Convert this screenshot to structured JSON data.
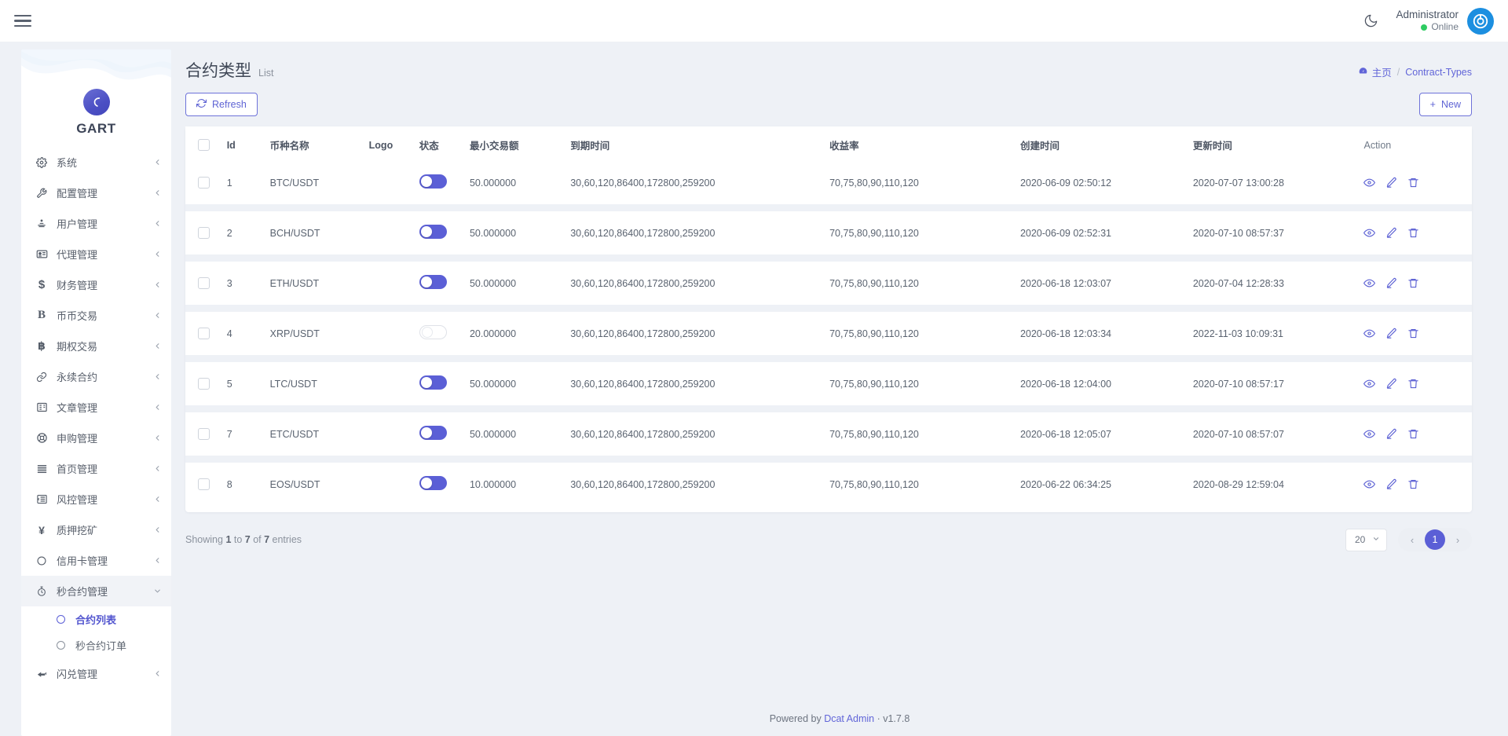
{
  "topbar": {
    "menu_icon": "hamburger-icon",
    "theme_icon": "moon-icon",
    "user_name": "Administrator",
    "user_status": "Online",
    "status_color": "#2ecc62"
  },
  "sidebar": {
    "brand": "GART",
    "items": [
      {
        "label": "系统",
        "icon": "gear-icon",
        "expandable": true
      },
      {
        "label": "配置管理",
        "icon": "wrench-icon",
        "expandable": true
      },
      {
        "label": "用户管理",
        "icon": "users-icon",
        "expandable": true
      },
      {
        "label": "代理管理",
        "icon": "id-card-icon",
        "expandable": true
      },
      {
        "label": "财务管理",
        "icon": "dollar-icon",
        "expandable": true
      },
      {
        "label": "币币交易",
        "icon": "bold-b-icon",
        "expandable": true
      },
      {
        "label": "期权交易",
        "icon": "bitcoin-icon",
        "expandable": true
      },
      {
        "label": "永续合约",
        "icon": "link-icon",
        "expandable": true
      },
      {
        "label": "文章管理",
        "icon": "book-icon",
        "expandable": true
      },
      {
        "label": "申购管理",
        "icon": "lifebuoy-icon",
        "expandable": true
      },
      {
        "label": "首页管理",
        "icon": "bars-icon",
        "expandable": true
      },
      {
        "label": "风控管理",
        "icon": "list-indent-icon",
        "expandable": true
      },
      {
        "label": "质押挖矿",
        "icon": "yen-icon",
        "expandable": true
      },
      {
        "label": "信用卡管理",
        "icon": "circle-icon",
        "expandable": true
      }
    ],
    "expanded_group": {
      "label": "秒合约管理",
      "icon": "stopwatch-icon",
      "children": [
        {
          "label": "合约列表",
          "active": true
        },
        {
          "label": "秒合约订单",
          "active": false
        }
      ]
    },
    "last_item": {
      "label": "闪兑管理",
      "icon": "exchange-icon",
      "expandable": true
    }
  },
  "page": {
    "title": "合约类型",
    "subtitle": "List",
    "breadcrumb": {
      "home": "主页",
      "separator": "/",
      "current": "Contract-Types"
    },
    "refresh_label": "Refresh",
    "new_label": "New"
  },
  "table": {
    "columns": [
      "Id",
      "币种名称",
      "Logo",
      "状态",
      "最小交易额",
      "到期时间",
      "收益率",
      "创建时间",
      "更新时间",
      "Action"
    ],
    "rows": [
      {
        "id": "1",
        "symbol": "BTC/USDT",
        "state": true,
        "min": "50.000000",
        "expiry": "30,60,120,86400,172800,259200",
        "rate": "70,75,80,90,110,120",
        "created": "2020-06-09 02:50:12",
        "updated": "2020-07-07 13:00:28"
      },
      {
        "id": "2",
        "symbol": "BCH/USDT",
        "state": true,
        "min": "50.000000",
        "expiry": "30,60,120,86400,172800,259200",
        "rate": "70,75,80,90,110,120",
        "created": "2020-06-09 02:52:31",
        "updated": "2020-07-10 08:57:37"
      },
      {
        "id": "3",
        "symbol": "ETH/USDT",
        "state": true,
        "min": "50.000000",
        "expiry": "30,60,120,86400,172800,259200",
        "rate": "70,75,80,90,110,120",
        "created": "2020-06-18 12:03:07",
        "updated": "2020-07-04 12:28:33"
      },
      {
        "id": "4",
        "symbol": "XRP/USDT",
        "state": false,
        "min": "20.000000",
        "expiry": "30,60,120,86400,172800,259200",
        "rate": "70,75,80,90,110,120",
        "created": "2020-06-18 12:03:34",
        "updated": "2022-11-03 10:09:31"
      },
      {
        "id": "5",
        "symbol": "LTC/USDT",
        "state": true,
        "min": "50.000000",
        "expiry": "30,60,120,86400,172800,259200",
        "rate": "70,75,80,90,110,120",
        "created": "2020-06-18 12:04:00",
        "updated": "2020-07-10 08:57:17"
      },
      {
        "id": "7",
        "symbol": "ETC/USDT",
        "state": true,
        "min": "50.000000",
        "expiry": "30,60,120,86400,172800,259200",
        "rate": "70,75,80,90,110,120",
        "created": "2020-06-18 12:05:07",
        "updated": "2020-07-10 08:57:07"
      },
      {
        "id": "8",
        "symbol": "EOS/USDT",
        "state": true,
        "min": "10.000000",
        "expiry": "30,60,120,86400,172800,259200",
        "rate": "70,75,80,90,110,120",
        "created": "2020-06-22 06:34:25",
        "updated": "2020-08-29 12:59:04"
      }
    ],
    "row_actions": [
      "eye-icon",
      "pencil-icon",
      "trash-icon"
    ]
  },
  "pagination": {
    "showing": "Showing 1 to 7 of 7 entries",
    "showing_parts": {
      "prefix": "Showing ",
      "from": "1",
      "mid1": " to ",
      "to": "7",
      "mid2": " of ",
      "total": "7",
      "suffix": " entries"
    },
    "per_page": "20",
    "current_page": "1",
    "prev_label": "‹",
    "next_label": "›"
  },
  "footer": {
    "prefix": "Powered by ",
    "link": "Dcat Admin",
    "sep": " · ",
    "version": "v1.7.8"
  },
  "colors": {
    "accent": "#5b5fd6",
    "link": "#6165d8",
    "bg": "#eef1f6"
  }
}
